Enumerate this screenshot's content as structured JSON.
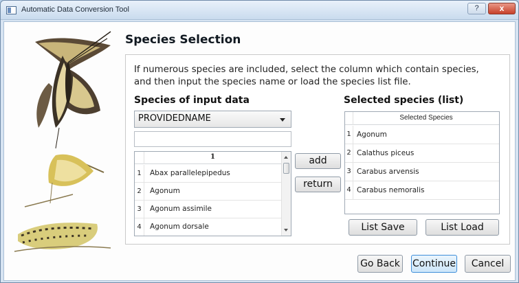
{
  "window": {
    "title": "Automatic Data Conversion Tool",
    "help_label": "?",
    "close_label": "x"
  },
  "page": {
    "heading": "Species Selection",
    "description": "If numerous species are included, select the column which contain species,\nand then input the species name or load the species list file."
  },
  "input_data": {
    "label": "Species of input data",
    "column_select": {
      "selected": "PROVIDEDNAME"
    },
    "search": {
      "value": "",
      "placeholder": ""
    },
    "grid": {
      "column_header": "1",
      "rows": [
        {
          "num": "1",
          "name": "Abax parallelepipedus"
        },
        {
          "num": "2",
          "name": "Agonum"
        },
        {
          "num": "3",
          "name": "Agonum assimile"
        },
        {
          "num": "4",
          "name": "Agonum dorsale"
        }
      ]
    }
  },
  "transfer": {
    "add_label": "add",
    "return_label": "return"
  },
  "selected": {
    "label": "Selected species (list)",
    "grid": {
      "column_header": "Selected Species",
      "rows": [
        {
          "num": "1",
          "name": "Agonum"
        },
        {
          "num": "2",
          "name": "Calathus piceus"
        },
        {
          "num": "3",
          "name": "Carabus arvensis"
        },
        {
          "num": "4",
          "name": "Carabus nemoralis"
        }
      ]
    },
    "list_save_label": "List Save",
    "list_load_label": "List Load"
  },
  "footer": {
    "go_back_label": "Go Back",
    "continue_label": "Continue",
    "cancel_label": "Cancel"
  },
  "colors": {
    "accent": "#3c8dd9",
    "window_frame": "#b9d1ea",
    "close": "#c7402a"
  },
  "icons": {
    "app": "app-window-icon",
    "combo_arrow": "chevron-down-icon",
    "scroll_up": "scroll-up-arrow-icon",
    "scroll_down": "scroll-down-arrow-icon"
  }
}
